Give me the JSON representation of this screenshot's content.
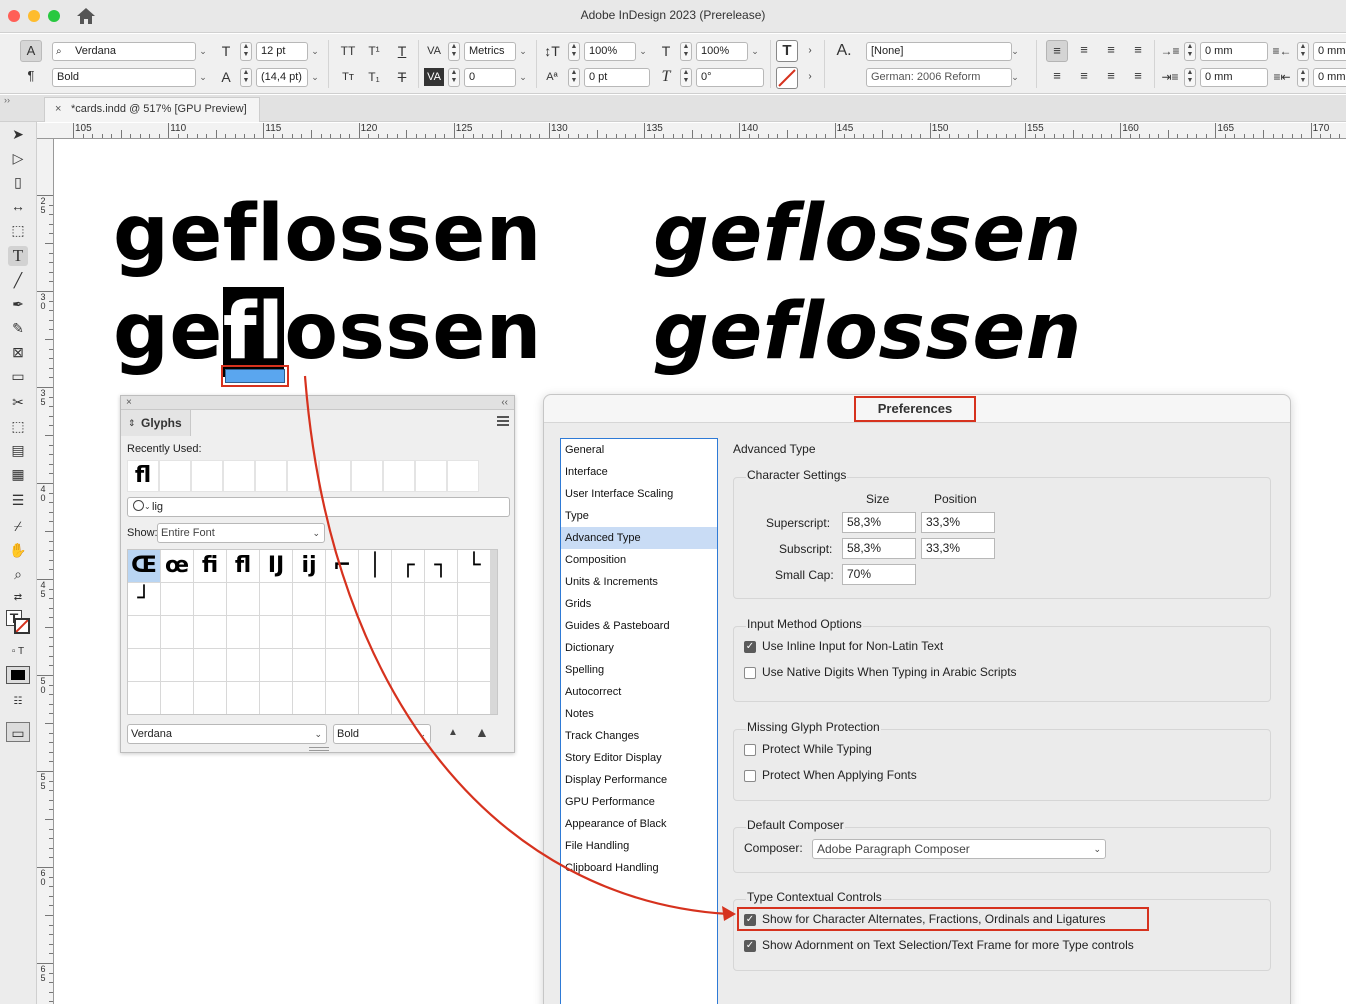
{
  "window": {
    "title": "Adobe InDesign 2023 (Prerelease)"
  },
  "control_panel": {
    "font_family": "Verdana",
    "font_style": "Bold",
    "font_size": "12 pt",
    "leading": "(14,4 pt)",
    "kerning": "Metrics",
    "tracking": "0",
    "vertical_scale": "100%",
    "horizontal_scale": "100%",
    "baseline_shift": "0 pt",
    "skew": "0°",
    "character_style": "[None]",
    "language": "German: 2006 Reform",
    "left_indent": "0 mm",
    "first_line_indent": "0 mm",
    "right_indent": "0 mm",
    "last_line_indent": "0 mm",
    "icons": [
      "type-size-icon",
      "leading-icon",
      "all-caps-icon",
      "superscript-icon",
      "underline-icon",
      "small-caps-icon",
      "subscript-icon",
      "strikethrough-icon",
      "kerning-icon",
      "tracking-icon",
      "vertical-scale-icon",
      "horizontal-scale-icon",
      "baseline-shift-icon",
      "skew-icon",
      "fill-icon",
      "stroke-none-icon",
      "character-style-icon",
      "align-left-icon",
      "align-center-icon",
      "align-right-icon",
      "justify-icon"
    ]
  },
  "document_tab": {
    "close": "×",
    "label": "*cards.indd @ 517% [GPU Preview]"
  },
  "ruler": {
    "h_labels": [
      "105",
      "110",
      "115",
      "120",
      "125",
      "130",
      "135",
      "140",
      "145",
      "150",
      "155",
      "160",
      "165",
      "170"
    ],
    "v_labels": [
      "2\n5",
      "3\n0",
      "3\n5",
      "4\n0",
      "4\n5",
      "5\n0",
      "5\n5",
      "6\n0",
      "6\n5"
    ]
  },
  "canvas": {
    "line1_bold": "geflossen",
    "line1_italic": "geflossen",
    "line2_prefix": "ge",
    "line2_selected": "fl",
    "line2_suffix": "ossen",
    "line2_italic": "geflossen"
  },
  "glyphs_panel": {
    "close": "×",
    "collapse": "‹‹",
    "title": "Glyphs",
    "recently_used_label": "Recently Used:",
    "recently_used": [
      "ﬂ",
      "",
      "",
      "",
      "",
      "",
      "",
      "",
      "",
      "",
      ""
    ],
    "search_value": "lig",
    "show_label": "Show:",
    "show_value": "Entire Font",
    "glyphs": [
      "Œ",
      "œ",
      "ﬁ",
      "ﬂ",
      "Ĳ",
      "ĳ",
      "⌐",
      "│",
      "┌",
      "┐",
      "└",
      "┘",
      "",
      "",
      "",
      "",
      "",
      "",
      "",
      "",
      "",
      "",
      "",
      "",
      "",
      "",
      "",
      "",
      "",
      "",
      "",
      "",
      "",
      "",
      "",
      "",
      "",
      "",
      "",
      "",
      "",
      "",
      "",
      "",
      "",
      "",
      "",
      "",
      "",
      "",
      "",
      "",
      "",
      "",
      ""
    ],
    "font": "Verdana",
    "style": "Bold"
  },
  "preferences": {
    "title": "Preferences",
    "nav": [
      "General",
      "Interface",
      "User Interface Scaling",
      "Type",
      "Advanced Type",
      "Composition",
      "Units & Increments",
      "Grids",
      "Guides & Pasteboard",
      "Dictionary",
      "Spelling",
      "Autocorrect",
      "Notes",
      "Track Changes",
      "Story Editor Display",
      "Display Performance",
      "GPU Performance",
      "Appearance of Black",
      "File Handling",
      "Clipboard Handling"
    ],
    "selected_nav": "Advanced Type",
    "heading": "Advanced Type",
    "character_settings": {
      "title": "Character Settings",
      "size_header": "Size",
      "position_header": "Position",
      "superscript_label": "Superscript:",
      "superscript_size": "58,3%",
      "superscript_position": "33,3%",
      "subscript_label": "Subscript:",
      "subscript_size": "58,3%",
      "subscript_position": "33,3%",
      "small_cap_label": "Small Cap:",
      "small_cap": "70%"
    },
    "input_method": {
      "title": "Input Method Options",
      "inline_input": "Use Inline Input for Non-Latin Text",
      "native_digits": "Use Native Digits When Typing in Arabic Scripts"
    },
    "missing_glyph": {
      "title": "Missing Glyph Protection",
      "protect_typing": "Protect While Typing",
      "protect_fonts": "Protect When Applying Fonts"
    },
    "composer": {
      "title": "Default Composer",
      "label": "Composer:",
      "value": "Adobe Paragraph Composer"
    },
    "contextual": {
      "title": "Type Contextual Controls",
      "show_alternates": "Show for Character Alternates, Fractions, Ordinals and Ligatures",
      "show_adornment": "Show Adornment on Text Selection/Text Frame for more Type controls"
    }
  },
  "colors": {
    "annotation_red": "#d6321e",
    "selection_blue": "#5aa6ef",
    "nav_highlight": "#c9dcf5"
  }
}
